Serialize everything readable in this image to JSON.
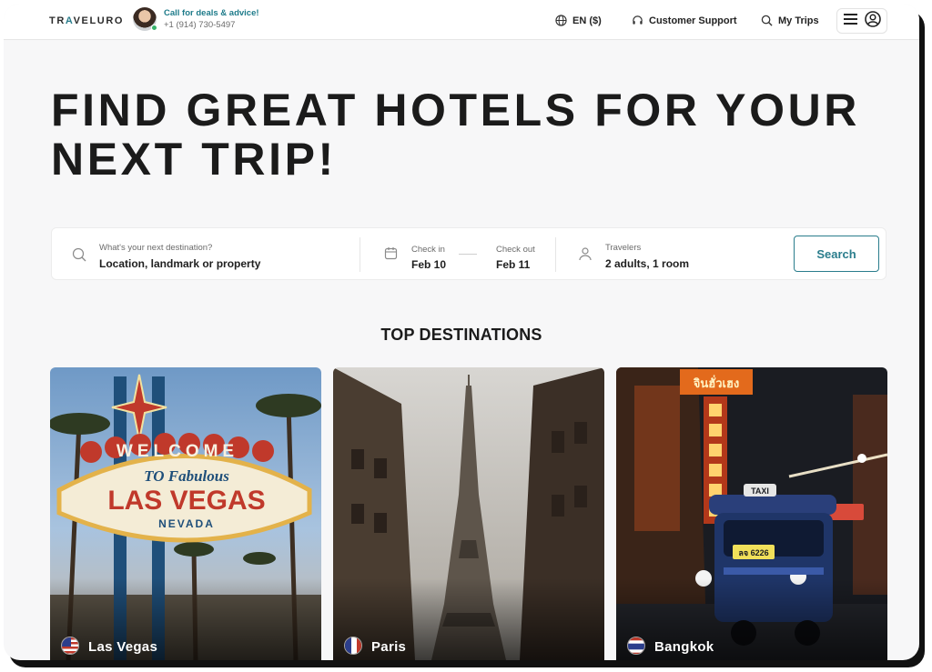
{
  "header": {
    "logo_pre": "TR",
    "logo_accent": "A",
    "logo_post": "VELURO",
    "agent_cta": "Call for deals & advice!",
    "agent_phone": "+1 (914) 730-5497",
    "language": "EN ($)",
    "support": "Customer Support",
    "trips": "My Trips"
  },
  "hero": {
    "title_line1": "FIND GREAT HOTELS FOR YOUR",
    "title_line2": "NEXT TRIP!"
  },
  "search": {
    "destination_label": "What's your next destination?",
    "destination_value": "Location, landmark or property",
    "checkin_label": "Check in",
    "checkin_value": "Feb 10",
    "checkout_label": "Check out",
    "checkout_value": "Feb 11",
    "travelers_label": "Travelers",
    "travelers_value": "2 adults, 1 room",
    "button": "Search"
  },
  "destinations": {
    "title": "TOP DESTINATIONS",
    "items": [
      {
        "name": "Las Vegas",
        "flag": "us-flag-icon"
      },
      {
        "name": "Paris",
        "flag": "france-flag-icon"
      },
      {
        "name": "Bangkok",
        "flag": "thailand-flag-icon"
      }
    ]
  },
  "colors": {
    "accent": "#2a7d8c",
    "online": "#38b26b"
  }
}
